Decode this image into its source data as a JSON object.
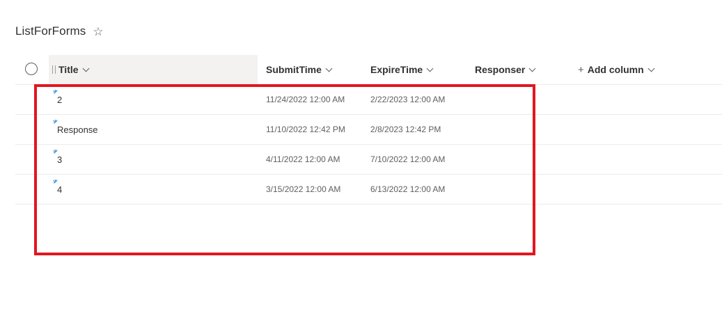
{
  "list": {
    "title": "ListForForms",
    "favorite_icon": "star-outline-icon"
  },
  "columns": [
    {
      "label": "Title"
    },
    {
      "label": "SubmitTime"
    },
    {
      "label": "ExpireTime"
    },
    {
      "label": "Responser"
    },
    {
      "label": "Add column"
    }
  ],
  "rows": [
    {
      "title": "2",
      "submit_time": "11/24/2022 12:00 AM",
      "expire_time": "2/22/2023 12:00 AM",
      "responser": ""
    },
    {
      "title": "Response",
      "submit_time": "11/10/2022 12:42 PM",
      "expire_time": "2/8/2023 12:42 PM",
      "responser": ""
    },
    {
      "title": "3",
      "submit_time": "4/11/2022 12:00 AM",
      "expire_time": "7/10/2022 12:00 AM",
      "responser": ""
    },
    {
      "title": "4",
      "submit_time": "3/15/2022 12:00 AM",
      "expire_time": "6/13/2022 12:00 AM",
      "responser": ""
    }
  ],
  "colors": {
    "highlight": "#e3161f",
    "new_indicator": "#0078d4",
    "header_bg": "#f3f2f1"
  }
}
